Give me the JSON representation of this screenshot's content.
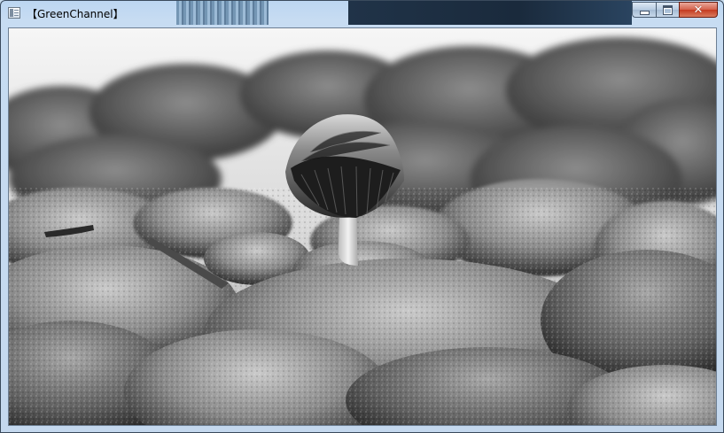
{
  "window": {
    "title": "【GreenChannel】",
    "icon": "app-window-icon"
  },
  "caption_buttons": {
    "minimize": "minimize-icon",
    "maximize": "maximize-icon",
    "close": "close-icon",
    "close_glyph": "✕"
  },
  "content": {
    "image_subject": "photo-viewer-image",
    "colors": {
      "close_red": "#c43a20",
      "frame_blue": "#c4d8ee"
    }
  }
}
